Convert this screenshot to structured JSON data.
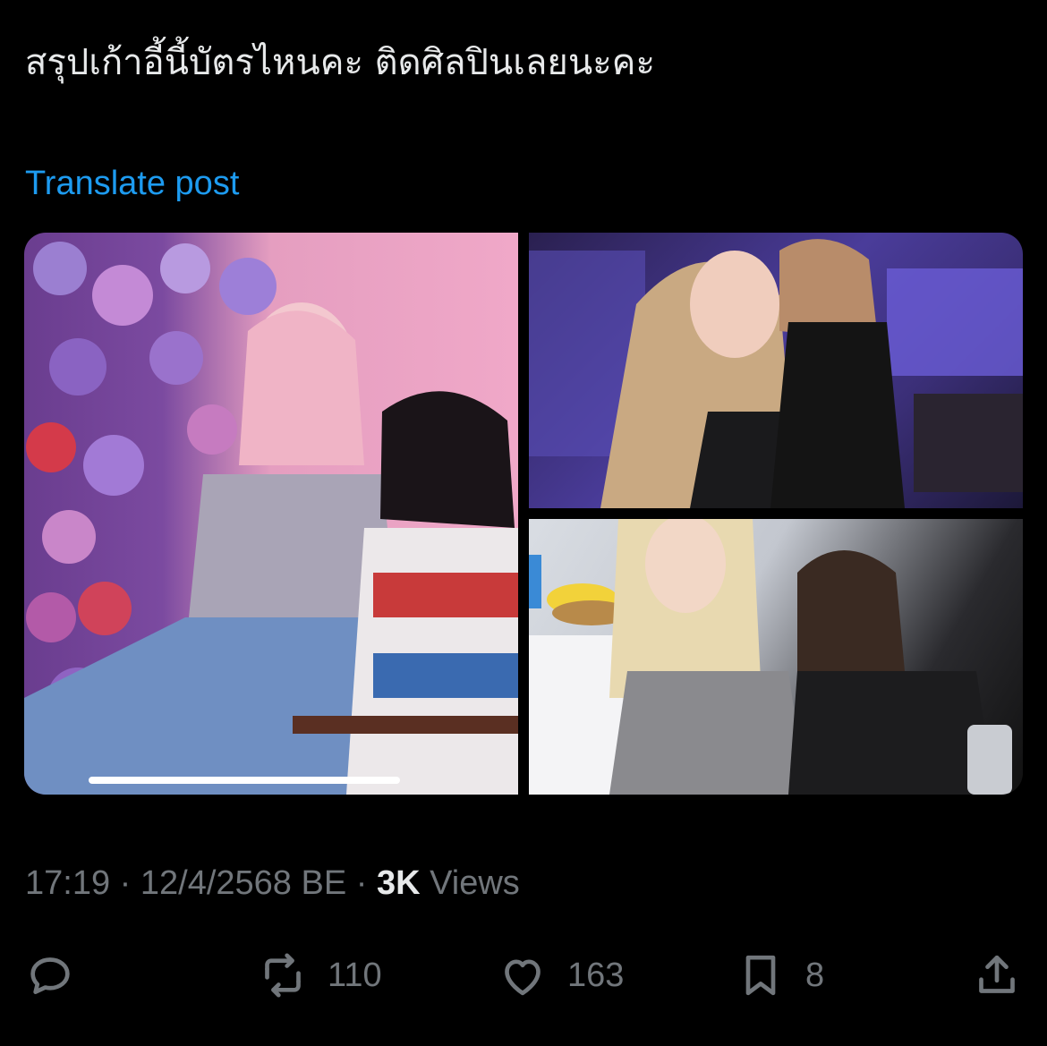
{
  "post": {
    "text": "สรุปเก้าอี้นี้บัตรไหนคะ ติดศิลปินเลยนะคะ",
    "translate_label": "Translate post"
  },
  "media": {
    "count": 3,
    "video_progress": 1.0
  },
  "meta": {
    "time": "17:19",
    "separator": "·",
    "date": "12/4/2568 BE",
    "views_count": "3K",
    "views_label": "Views"
  },
  "actions": {
    "reply": {
      "icon": "reply-icon",
      "count": ""
    },
    "repost": {
      "icon": "repost-icon",
      "count": "110"
    },
    "like": {
      "icon": "heart-icon",
      "count": "163"
    },
    "bookmark": {
      "icon": "bookmark-icon",
      "count": "8"
    },
    "share": {
      "icon": "share-icon",
      "count": ""
    }
  },
  "colors": {
    "background": "#000000",
    "text": "#e7e9ea",
    "secondary": "#71767b",
    "link": "#1d9bf0"
  }
}
